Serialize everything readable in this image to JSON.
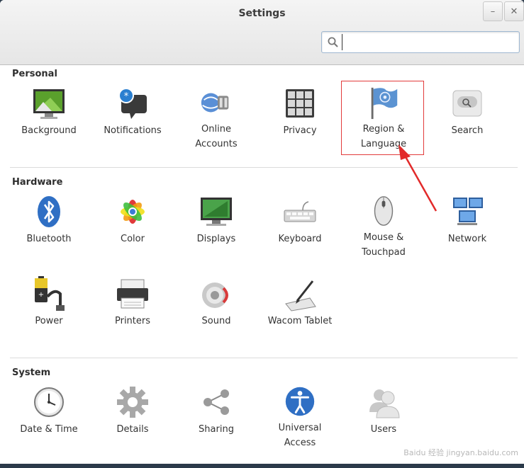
{
  "window": {
    "title": "Settings",
    "minimize_glyph": "–",
    "close_glyph": "✕"
  },
  "search": {
    "placeholder": "",
    "value": "",
    "icon": "search-icon"
  },
  "sections": [
    {
      "title": "Personal",
      "items": [
        {
          "id": "background",
          "label": "Background",
          "icon": "background-icon"
        },
        {
          "id": "notifications",
          "label": "Notifications",
          "icon": "notifications-icon"
        },
        {
          "id": "online-accounts",
          "label": "Online\nAccounts",
          "icon": "online-accounts-icon"
        },
        {
          "id": "privacy",
          "label": "Privacy",
          "icon": "privacy-icon"
        },
        {
          "id": "region-language",
          "label": "Region &\nLanguage",
          "icon": "flag-icon"
        },
        {
          "id": "search",
          "label": "Search",
          "icon": "search-settings-icon"
        }
      ]
    },
    {
      "title": "Hardware",
      "items": [
        {
          "id": "bluetooth",
          "label": "Bluetooth",
          "icon": "bluetooth-icon"
        },
        {
          "id": "color",
          "label": "Color",
          "icon": "color-icon"
        },
        {
          "id": "displays",
          "label": "Displays",
          "icon": "display-icon"
        },
        {
          "id": "keyboard",
          "label": "Keyboard",
          "icon": "keyboard-icon"
        },
        {
          "id": "mouse",
          "label": "Mouse &\nTouchpad",
          "icon": "mouse-icon"
        },
        {
          "id": "network",
          "label": "Network",
          "icon": "network-icon"
        },
        {
          "id": "power",
          "label": "Power",
          "icon": "battery-icon"
        },
        {
          "id": "printers",
          "label": "Printers",
          "icon": "printer-icon"
        },
        {
          "id": "sound",
          "label": "Sound",
          "icon": "speaker-icon"
        },
        {
          "id": "wacom",
          "label": "Wacom Tablet",
          "icon": "tablet-icon"
        }
      ]
    },
    {
      "title": "System",
      "items": [
        {
          "id": "datetime",
          "label": "Date & Time",
          "icon": "clock-icon"
        },
        {
          "id": "details",
          "label": "Details",
          "icon": "gear-icon"
        },
        {
          "id": "sharing",
          "label": "Sharing",
          "icon": "share-icon"
        },
        {
          "id": "universal-access",
          "label": "Universal\nAccess",
          "icon": "accessibility-icon"
        },
        {
          "id": "users",
          "label": "Users",
          "icon": "users-icon"
        }
      ]
    }
  ],
  "annotation": {
    "highlighted_item": "region-language",
    "highlight_color": "#e23b3b"
  },
  "watermark": "Baidu 经验 jingyan.baidu.com",
  "colors": {
    "accent": "#4a90d9",
    "title_text": "#3c3c3c"
  }
}
